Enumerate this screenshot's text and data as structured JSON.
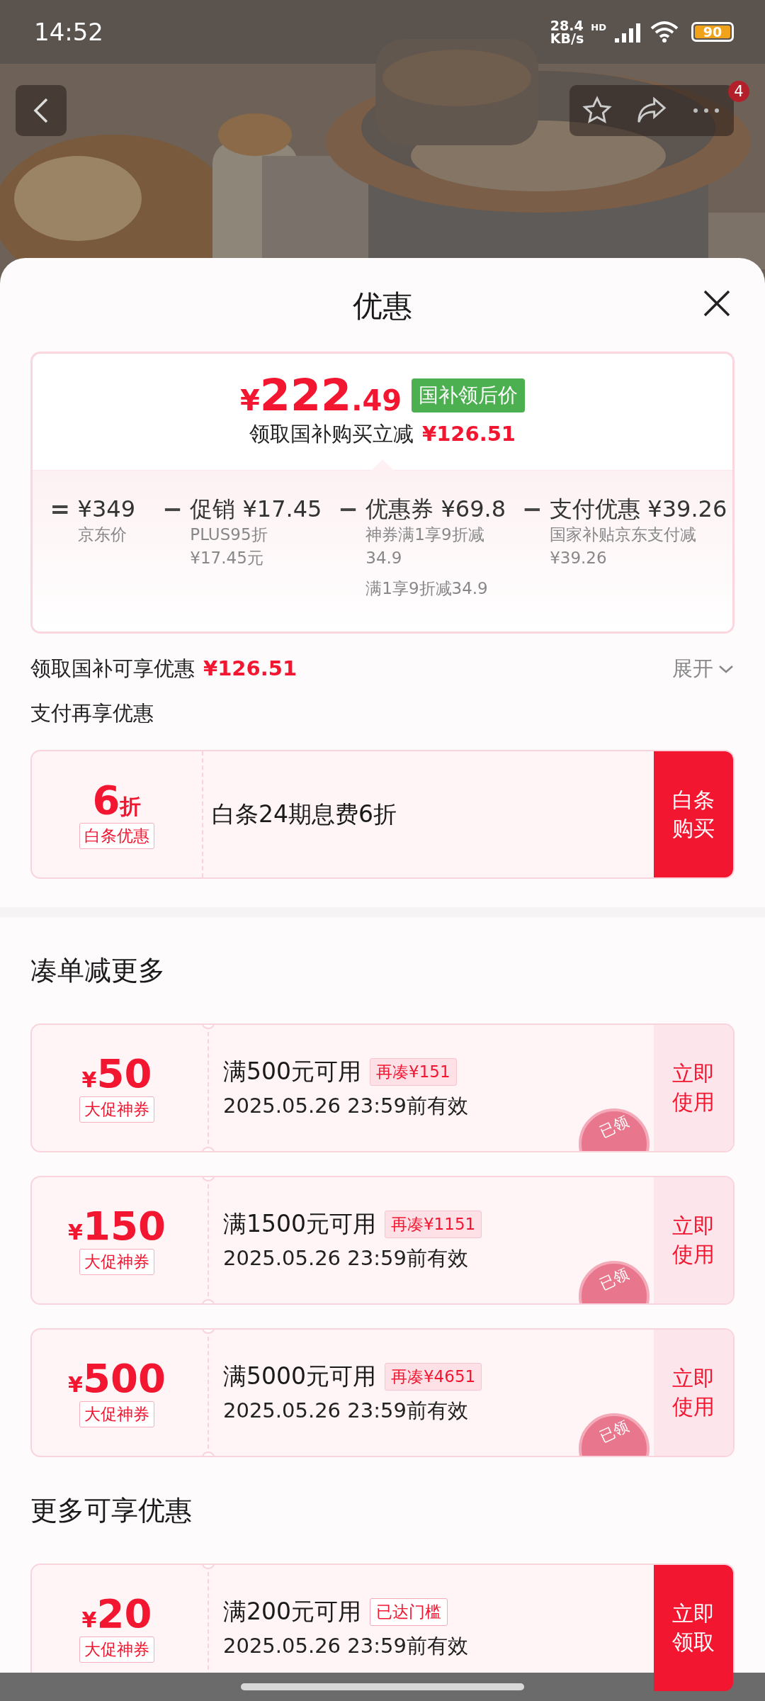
{
  "status_bar": {
    "time": "14:52",
    "net_speed": "28.4",
    "net_unit": "KB/s",
    "net_type": "HD",
    "battery": "90"
  },
  "top_bar": {
    "badge": "4"
  },
  "sheet": {
    "title": "优惠"
  },
  "price_card": {
    "currency": "¥",
    "integer": "222",
    "decimal": ".49",
    "tag": "国补领后价",
    "subtitle": "领取国补购买立减",
    "subtitle_amount": "¥126.51",
    "breakdown": [
      {
        "op": "=",
        "title": "¥349",
        "notes": [
          [
            "京东价"
          ]
        ]
      },
      {
        "op": "−",
        "title": "促销 ¥17.45",
        "notes": [
          [
            "PLUS95折",
            "¥17.45元"
          ]
        ]
      },
      {
        "op": "−",
        "title": "优惠券 ¥69.8",
        "notes": [
          [
            "神券满1享9折减",
            "34.9"
          ],
          [
            "满1享9折减34.9"
          ]
        ]
      },
      {
        "op": "−",
        "title": "支付优惠 ¥39.26",
        "notes": [
          [
            "国家补贴京东支付减",
            "¥39.26"
          ]
        ]
      }
    ]
  },
  "subsidy_row": {
    "label": "领取国补可享优惠",
    "amount": "¥126.51",
    "toggle": "展开",
    "expanded": false
  },
  "payment_section": {
    "title": "支付再享优惠",
    "offer": {
      "value": "6",
      "unit": "折",
      "tag": "白条优惠",
      "text": "白条24期息费6折",
      "action": "白条购买"
    }
  },
  "sections": [
    {
      "title": "凑单减更多",
      "coupons": [
        {
          "symbol": "¥",
          "amount": "50",
          "tag": "大促神券",
          "condition": "满500元可用",
          "badge": "再凑¥151",
          "kind": "shortfall",
          "validity": "2025.05.26 23:59前有效",
          "action": "立即使用",
          "claimed": true,
          "stamp": "已领"
        },
        {
          "symbol": "¥",
          "amount": "150",
          "tag": "大促神券",
          "condition": "满1500元可用",
          "badge": "再凑¥1151",
          "kind": "shortfall",
          "validity": "2025.05.26 23:59前有效",
          "action": "立即使用",
          "claimed": true,
          "stamp": "已领"
        },
        {
          "symbol": "¥",
          "amount": "500",
          "tag": "大促神券",
          "condition": "满5000元可用",
          "badge": "再凑¥4651",
          "kind": "shortfall",
          "validity": "2025.05.26 23:59前有效",
          "action": "立即使用",
          "claimed": true,
          "stamp": "已领"
        }
      ]
    },
    {
      "title": "更多可享优惠",
      "coupons": [
        {
          "symbol": "¥",
          "amount": "20",
          "tag": "大促神券",
          "condition": "满200元可用",
          "badge": "已达门槛",
          "kind": "reached",
          "validity": "2025.05.26 23:59前有效",
          "action": "立即领取",
          "claimed": false
        }
      ]
    }
  ]
}
